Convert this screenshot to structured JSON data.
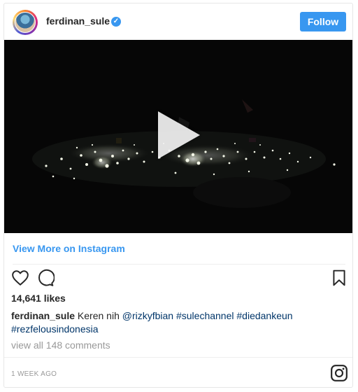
{
  "post": {
    "username": "ferdinan_sule",
    "verified_badge": "verified-badge",
    "follow_label": "Follow",
    "video_icon": "play-icon",
    "view_more_label": "View More on Instagram",
    "likes": "14,641 likes",
    "caption_user": "ferdinan_sule",
    "caption_text": "Keren nih",
    "caption_mention": "@rizkyfbian",
    "caption_tag_1": "#sulechannel",
    "caption_tag_2": "#diedankeun",
    "caption_tag_3": "#rezfelousindonesia",
    "comments_link": "view all 148 comments",
    "timestamp": "1 WEEK AGO"
  },
  "icons": {
    "heart": "heart-icon",
    "comment": "comment-icon",
    "bookmark": "bookmark-icon",
    "instagram": "instagram-logo-icon"
  },
  "colors": {
    "accent": "#3897f0",
    "text": "#262626",
    "muted": "#999999",
    "hashtag": "#003569"
  }
}
